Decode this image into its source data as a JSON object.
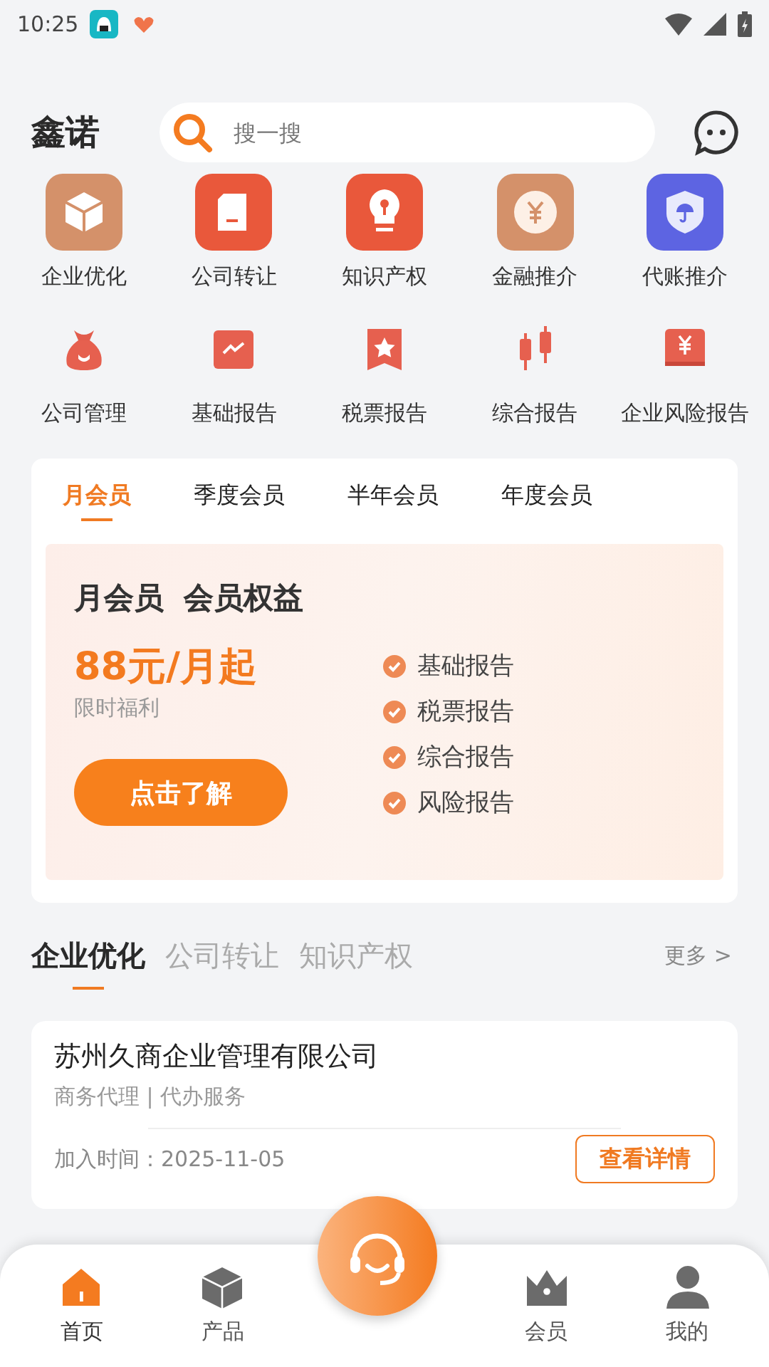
{
  "status_bar": {
    "time": "10:25"
  },
  "header": {
    "brand": "鑫诺",
    "search": {
      "placeholder": "搜一搜"
    }
  },
  "shortcuts": [
    {
      "label": "企业优化",
      "kind": "box"
    },
    {
      "label": "公司转让",
      "kind": "card"
    },
    {
      "label": "知识产权",
      "kind": "bulb"
    },
    {
      "label": "金融推介",
      "kind": "coin"
    },
    {
      "label": "代账推介",
      "kind": "shield"
    },
    {
      "label": "公司管理",
      "kind": "bag"
    },
    {
      "label": "基础报告",
      "kind": "chart"
    },
    {
      "label": "税票报告",
      "kind": "ribbon"
    },
    {
      "label": "综合报告",
      "kind": "candles"
    },
    {
      "label": "企业风险报告",
      "kind": "safe"
    }
  ],
  "membership": {
    "tabs": [
      {
        "label": "月会员",
        "selected": true
      },
      {
        "label": "季度会员",
        "selected": false
      },
      {
        "label": "半年会员",
        "selected": false
      },
      {
        "label": "年度会员",
        "selected": false
      }
    ],
    "plan": {
      "title": "月会员",
      "subtitle": "会员权益",
      "price": "88元/月起",
      "note": "限时福利",
      "button": "点击了解",
      "benefits": [
        "基础报告",
        "税票报告",
        "综合报告",
        "风险报告"
      ]
    }
  },
  "sections": {
    "tabs": [
      {
        "label": "企业优化",
        "selected": true
      },
      {
        "label": "公司转让",
        "selected": false
      },
      {
        "label": "知识产权",
        "selected": false
      }
    ],
    "more": "更多 >"
  },
  "listing": {
    "company": "苏州久商企业管理有限公司",
    "tags": "商务代理 | 代办服务",
    "joined": "加入时间：2025-11-05",
    "button": "查看详情"
  },
  "bottom_nav": [
    {
      "label": "首页",
      "kind": "home",
      "selected": true
    },
    {
      "label": "产品",
      "kind": "product",
      "selected": false
    },
    {
      "label": "会员",
      "kind": "crown",
      "selected": false
    },
    {
      "label": "我的",
      "kind": "person",
      "selected": false
    }
  ]
}
